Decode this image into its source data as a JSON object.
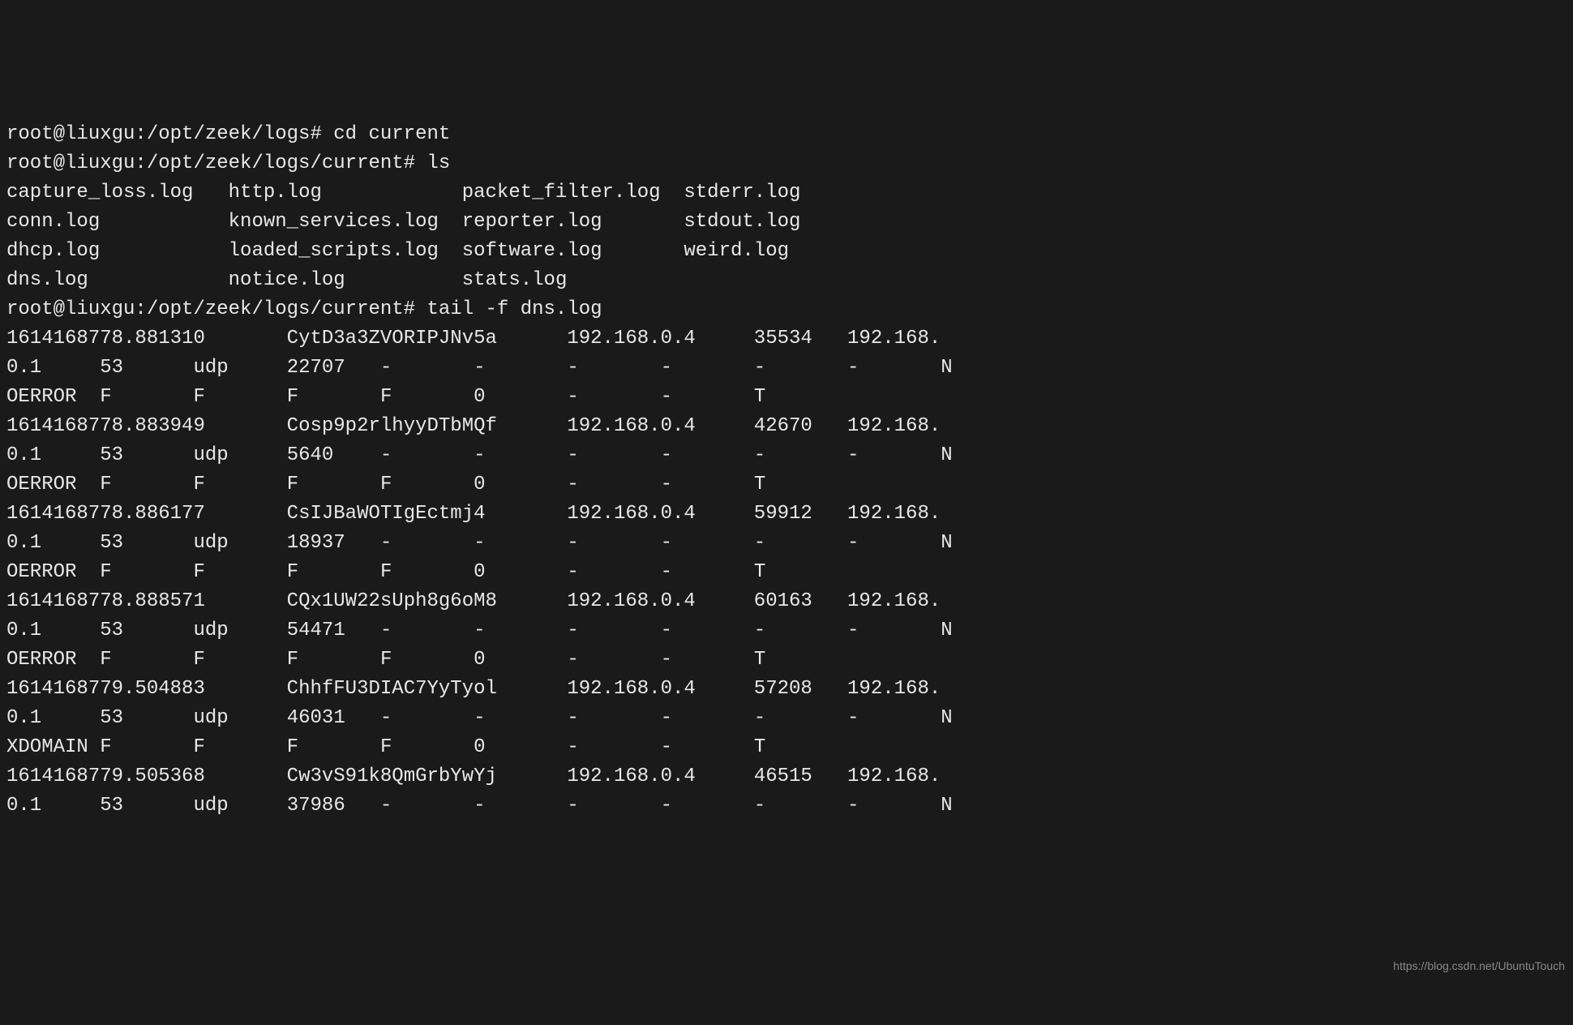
{
  "prompts": {
    "p1": "root@liuxgu:/opt/zeek/logs# ",
    "p2": "root@liuxgu:/opt/zeek/logs/current# "
  },
  "commands": {
    "cd": "cd current",
    "ls": "ls",
    "tail": "tail -f dns.log"
  },
  "ls_output": {
    "col1": [
      "capture_loss.log",
      "conn.log",
      "dhcp.log",
      "dns.log"
    ],
    "col2": [
      "http.log",
      "known_services.log",
      "loaded_scripts.log",
      "notice.log"
    ],
    "col3": [
      "packet_filter.log",
      "reporter.log",
      "software.log",
      "stats.log"
    ],
    "col4": [
      "stderr.log",
      "stdout.log",
      "weird.log"
    ]
  },
  "log_records": [
    {
      "ts": "1614168778.881310",
      "uid": "CytD3a3ZVORIPJNv5a",
      "orig_h": "192.168.0.4",
      "orig_p": "35534",
      "resp_h": "192.168.",
      "resp_h2": "0.1",
      "resp_p": "53",
      "proto": "udp",
      "trans_id": "22707",
      "tail_n": "N",
      "err": "OERROR",
      "f1": "F",
      "f2": "F",
      "f3": "F",
      "f4": "F",
      "zero": "0",
      "t": "T"
    },
    {
      "ts": "1614168778.883949",
      "uid": "Cosp9p2rlhyyDTbMQf",
      "orig_h": "192.168.0.4",
      "orig_p": "42670",
      "resp_h": "192.168.",
      "resp_h2": "0.1",
      "resp_p": "53",
      "proto": "udp",
      "trans_id": "5640",
      "tail_n": "N",
      "err": "OERROR",
      "f1": "F",
      "f2": "F",
      "f3": "F",
      "f4": "F",
      "zero": "0",
      "t": "T"
    },
    {
      "ts": "1614168778.886177",
      "uid": "CsIJBaWOTIgEctmj4",
      "orig_h": "192.168.0.4",
      "orig_p": "59912",
      "resp_h": "192.168.",
      "resp_h2": "0.1",
      "resp_p": "53",
      "proto": "udp",
      "trans_id": "18937",
      "tail_n": "N",
      "err": "OERROR",
      "f1": "F",
      "f2": "F",
      "f3": "F",
      "f4": "F",
      "zero": "0",
      "t": "T"
    },
    {
      "ts": "1614168778.888571",
      "uid": "CQx1UW22sUph8g6oM8",
      "orig_h": "192.168.0.4",
      "orig_p": "60163",
      "resp_h": "192.168.",
      "resp_h2": "0.1",
      "resp_p": "53",
      "proto": "udp",
      "trans_id": "54471",
      "tail_n": "N",
      "err": "OERROR",
      "f1": "F",
      "f2": "F",
      "f3": "F",
      "f4": "F",
      "zero": "0",
      "t": "T"
    },
    {
      "ts": "1614168779.504883",
      "uid": "ChhfFU3DIAC7YyTyol",
      "orig_h": "192.168.0.4",
      "orig_p": "57208",
      "resp_h": "192.168.",
      "resp_h2": "0.1",
      "resp_p": "53",
      "proto": "udp",
      "trans_id": "46031",
      "tail_n": "N",
      "err": "XDOMAIN",
      "f1": "F",
      "f2": "F",
      "f3": "F",
      "f4": "F",
      "zero": "0",
      "t": "T"
    },
    {
      "ts": "1614168779.505368",
      "uid": "Cw3vS91k8QmGrbYwYj",
      "orig_h": "192.168.0.4",
      "orig_p": "46515",
      "resp_h": "192.168.",
      "resp_h2": "0.1",
      "resp_p": "53",
      "proto": "udp",
      "trans_id": "37986",
      "tail_n": "N",
      "err": "",
      "f1": "",
      "f2": "",
      "f3": "",
      "f4": "",
      "zero": "",
      "t": ""
    }
  ],
  "watermark": "https://blog.csdn.net/UbuntuTouch"
}
